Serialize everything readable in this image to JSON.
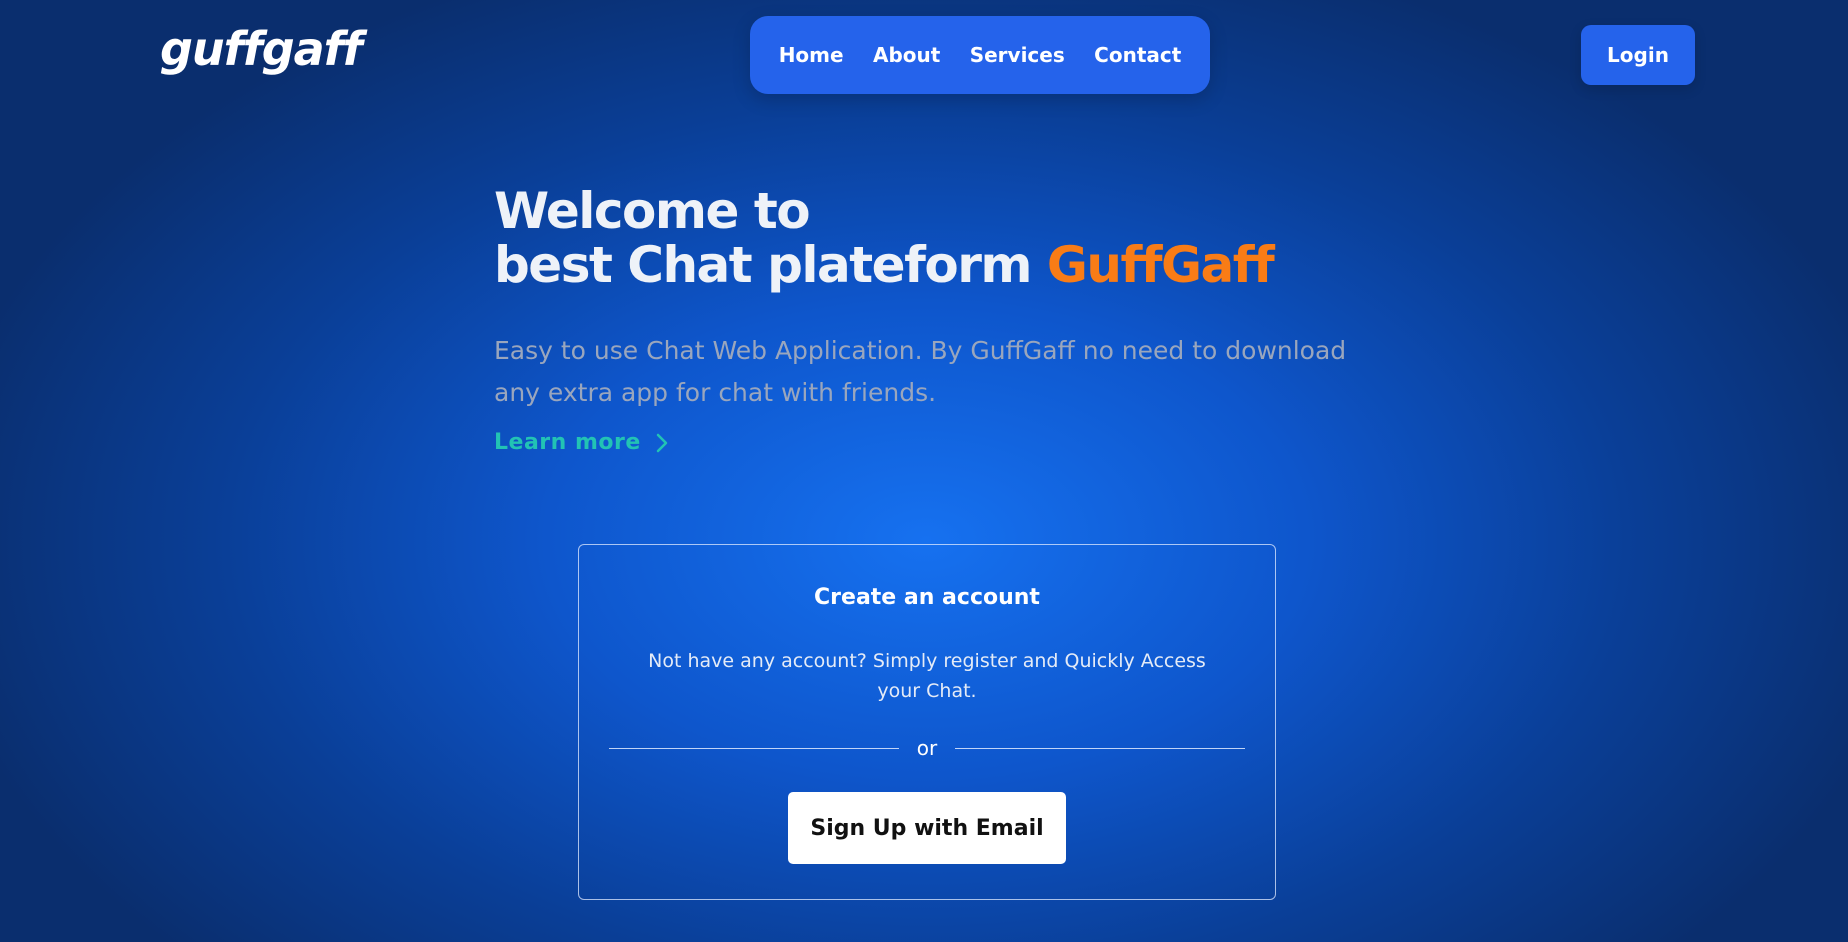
{
  "header": {
    "logo": "guffgaff",
    "nav": [
      {
        "label": "Home"
      },
      {
        "label": "About"
      },
      {
        "label": "Services"
      },
      {
        "label": "Contact"
      }
    ],
    "login_label": "Login"
  },
  "hero": {
    "title_line1": "Welcome to",
    "title_line2": "best Chat plateform ",
    "title_brand": "GuffGaff",
    "description": "Easy to use Chat Web Application. By GuffGaff no need to download any extra app for chat with friends.",
    "learn_more": "Learn more"
  },
  "signup_card": {
    "title": "Create an account",
    "text": "Not have any account? Simply register and Quickly Access your Chat.",
    "divider_text": "or",
    "button_label": "Sign Up with Email"
  },
  "colors": {
    "accent_blue": "#2563eb",
    "brand_orange": "#f97c16",
    "link_teal": "#22c3b4"
  },
  "icons": {
    "learn_more_icon": "chevron-right-icon"
  }
}
